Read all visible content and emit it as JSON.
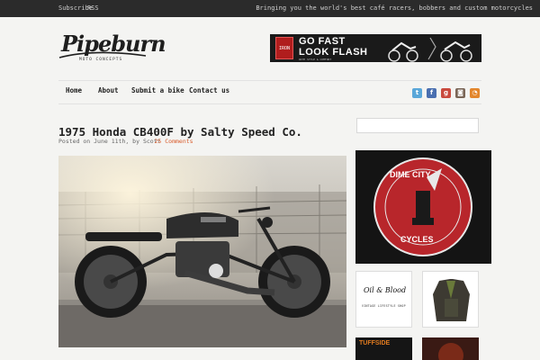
{
  "topbar": {
    "subscribe": "Subscribe",
    "rss": "RSS",
    "tagline": "Bringing you the world's best café racers, bobbers and custom motorcycles"
  },
  "logo": {
    "name": "Pipeburn",
    "sub": "moto concepts"
  },
  "banner": {
    "badge": "IRON",
    "line1": "GO FAST",
    "line2": "LOOK FLASH",
    "line3": "WITH STYLE & COMFORT"
  },
  "nav": {
    "items": [
      "Home",
      "About",
      "Submit a bike",
      "Contact us"
    ]
  },
  "social": {
    "icons": [
      "twitter-icon",
      "facebook-icon",
      "google-plus-icon",
      "instagram-icon",
      "rss-icon"
    ],
    "colors": [
      "#5aa7d9",
      "#4a6fb0",
      "#c94a3e",
      "#7a6657",
      "#e3862c"
    ]
  },
  "post": {
    "title": "1975 Honda CB400F by Salty Speed Co.",
    "meta_prefix": "Posted on June 11th, by",
    "author": "Scott",
    "comments": "25 Comments"
  },
  "sidebar": {
    "search_placeholder": "",
    "ad_dcc_line1": "DIME CITY",
    "ad_dcc_line2": "CYCLES",
    "ad_oab_title": "Oil & Blood",
    "ad_oab_sub": "VINTAGE LIFESTYLE SHOP",
    "ad_tuff": "TUFFSIDE"
  },
  "colors": {
    "topbar": "#2b2b2b",
    "page_bg": "#f4f4f2",
    "accent": "#d85a2a",
    "dcc_red": "#b8262b"
  }
}
